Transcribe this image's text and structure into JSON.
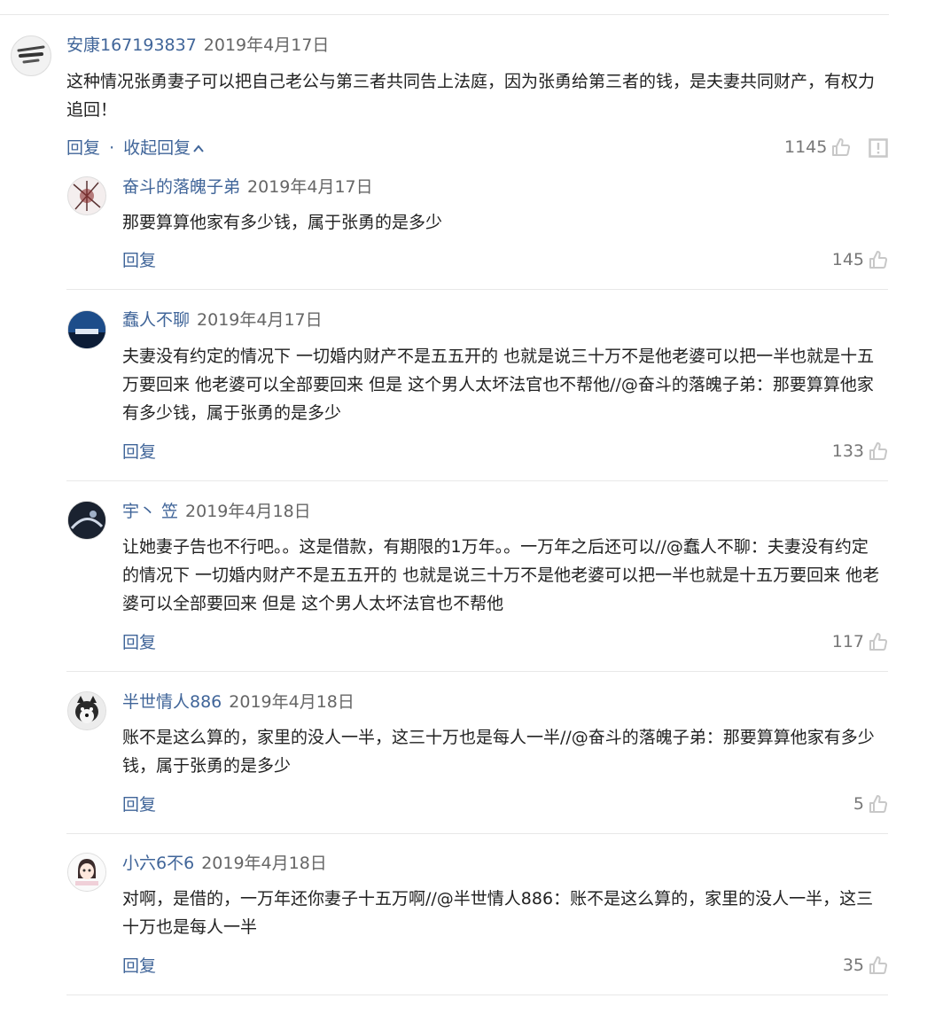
{
  "comment": {
    "user": "安康167193837",
    "date": "2019年4月17日",
    "text": "这种情况张勇妻子可以把自己老公与第三者共同告上法庭，因为张勇给第三者的钱，是夫妻共同财产，有权力追回！",
    "reply_label": "回复",
    "dot": "·",
    "collapse_label": "收起回复",
    "likes": "1145",
    "avatar_icon": "brush-stroke-avatar",
    "report_icon": "report-icon"
  },
  "replies": [
    {
      "user": "奋斗的落魄子弟",
      "date": "2019年4月17日",
      "text": "那要算算他家有多少钱，属于张勇的是多少",
      "reply_label": "回复",
      "likes": "145"
    },
    {
      "user": "蠢人不聊",
      "date": "2019年4月17日",
      "text": "夫妻没有约定的情况下 一切婚内财产不是五五开的 也就是说三十万不是他老婆可以把一半也就是十五万要回来 他老婆可以全部要回来 但是 这个男人太坏法官也不帮他//@奋斗的落魄子弟：那要算算他家有多少钱，属于张勇的是多少",
      "reply_label": "回复",
      "likes": "133"
    },
    {
      "user": "宇丶 笠",
      "date": "2019年4月18日",
      "text": "让她妻子告也不行吧。。这是借款，有期限的1万年。。一万年之后还可以//@蠢人不聊：夫妻没有约定的情况下 一切婚内财产不是五五开的 也就是说三十万不是他老婆可以把一半也就是十五万要回来 他老婆可以全部要回来 但是 这个男人太坏法官也不帮他",
      "reply_label": "回复",
      "likes": "117"
    },
    {
      "user": "半世情人886",
      "date": "2019年4月18日",
      "text": "账不是这么算的，家里的没人一半，这三十万也是每人一半//@奋斗的落魄子弟：那要算算他家有多少钱，属于张勇的是多少",
      "reply_label": "回复",
      "likes": "5"
    },
    {
      "user": "小六6不6",
      "date": "2019年4月18日",
      "text": "对啊，是借的，一万年还你妻子十五万啊//@半世情人886：账不是这么算的，家里的没人一半，这三十万也是每人一半",
      "reply_label": "回复",
      "likes": "35"
    }
  ],
  "colors": {
    "link": "#406599",
    "meta": "#666666",
    "text": "#222222",
    "divider": "#e8e8e8",
    "icon": "#c8c8c8"
  }
}
